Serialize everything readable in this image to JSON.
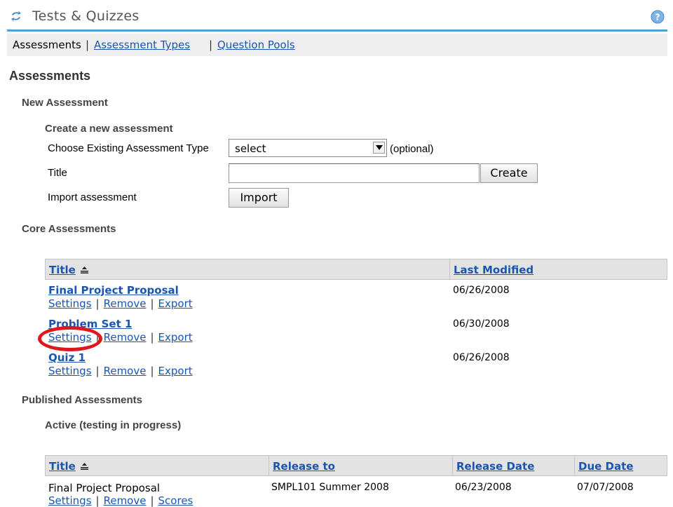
{
  "header": {
    "title": "Tests & Quizzes"
  },
  "nav": {
    "items": [
      "Assessments",
      "Assessment Types",
      "Question Pools"
    ],
    "separator": "|"
  },
  "page_title": "Assessments",
  "new_assessment": {
    "heading": "New Assessment",
    "subheading": "Create a new assessment",
    "type_label": "Choose Existing Assessment Type",
    "type_select_value": "select",
    "optional_note": "(optional)",
    "title_label": "Title",
    "title_value": "",
    "create_button": "Create",
    "import_label": "Import assessment",
    "import_button": "Import"
  },
  "core": {
    "heading": "Core Assessments",
    "columns": [
      "Title",
      "Last Modified"
    ],
    "actions": [
      "Settings",
      "Remove",
      "Export"
    ],
    "rows": [
      {
        "title": "Final Project Proposal",
        "last_modified": "06/26/2008"
      },
      {
        "title": "Problem Set 1",
        "last_modified": "06/30/2008"
      },
      {
        "title": "Quiz 1",
        "last_modified": "06/26/2008"
      }
    ]
  },
  "published": {
    "heading": "Published Assessments",
    "active_heading": "Active (testing in progress)",
    "columns": [
      "Title",
      "Release to",
      "Release Date",
      "Due Date"
    ],
    "actions": [
      "Settings",
      "Remove",
      "Scores"
    ],
    "rows": [
      {
        "title": "Final Project Proposal",
        "release_to": "SMPL101 Summer 2008",
        "release_date": "06/23/2008",
        "due_date": "07/07/2008"
      }
    ]
  },
  "colors": {
    "link": "#1a55b0",
    "accent_line": "#4aa3d4",
    "highlight": "#e0161d"
  }
}
